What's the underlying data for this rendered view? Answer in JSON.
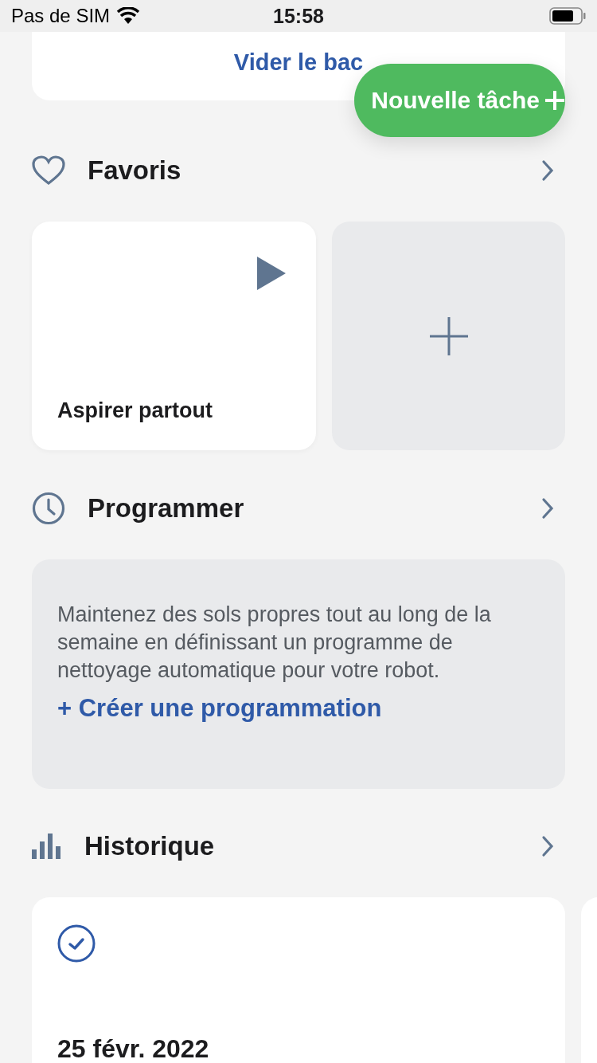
{
  "status_bar": {
    "carrier": "Pas de SIM",
    "time": "15:58"
  },
  "top_card": {
    "action": "Vider le bac"
  },
  "fab": {
    "label": "Nouvelle tâche"
  },
  "favorites": {
    "title": "Favoris",
    "items": [
      {
        "kind": "task",
        "label": "Aspirer partout"
      },
      {
        "kind": "add"
      }
    ]
  },
  "schedule": {
    "title": "Programmer",
    "description": "Maintenez des sols propres tout au long de la semaine en définissant un programme de nettoyage automatique pour votre robot.",
    "link": "+ Créer une programmation"
  },
  "history": {
    "title": "Historique",
    "entries": [
      {
        "completed": true,
        "date": "25 févr. 2022"
      }
    ]
  }
}
